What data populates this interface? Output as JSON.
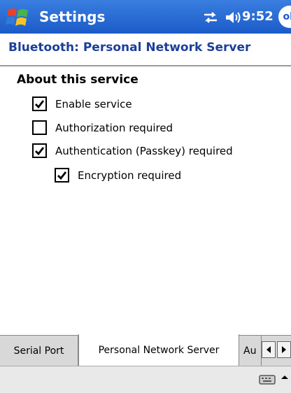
{
  "titlebar": {
    "app_title": "Settings",
    "clock": "9:52",
    "ok_label": "ok",
    "start_icon": "windows-flag-icon",
    "sync_icon": "connectivity-icon",
    "volume_icon": "speaker-icon",
    "accent": "#1b5bc8"
  },
  "page": {
    "title": "Bluetooth: Personal Network Server",
    "section_heading": "About this service"
  },
  "options": [
    {
      "label": "Enable service",
      "checked": true
    },
    {
      "label": "Authorization required",
      "checked": false
    },
    {
      "label": "Authentication (Passkey) required",
      "checked": true
    },
    {
      "label": "Encryption required",
      "checked": true
    }
  ],
  "tabs": [
    {
      "label": "Serial Port",
      "active": false
    },
    {
      "label": "Personal Network Server",
      "active": true
    },
    {
      "label": "Au",
      "active": false
    }
  ],
  "menubar": {
    "keyboard_icon": "keyboard-icon",
    "sip_icon": "input-panel-arrow-icon"
  }
}
